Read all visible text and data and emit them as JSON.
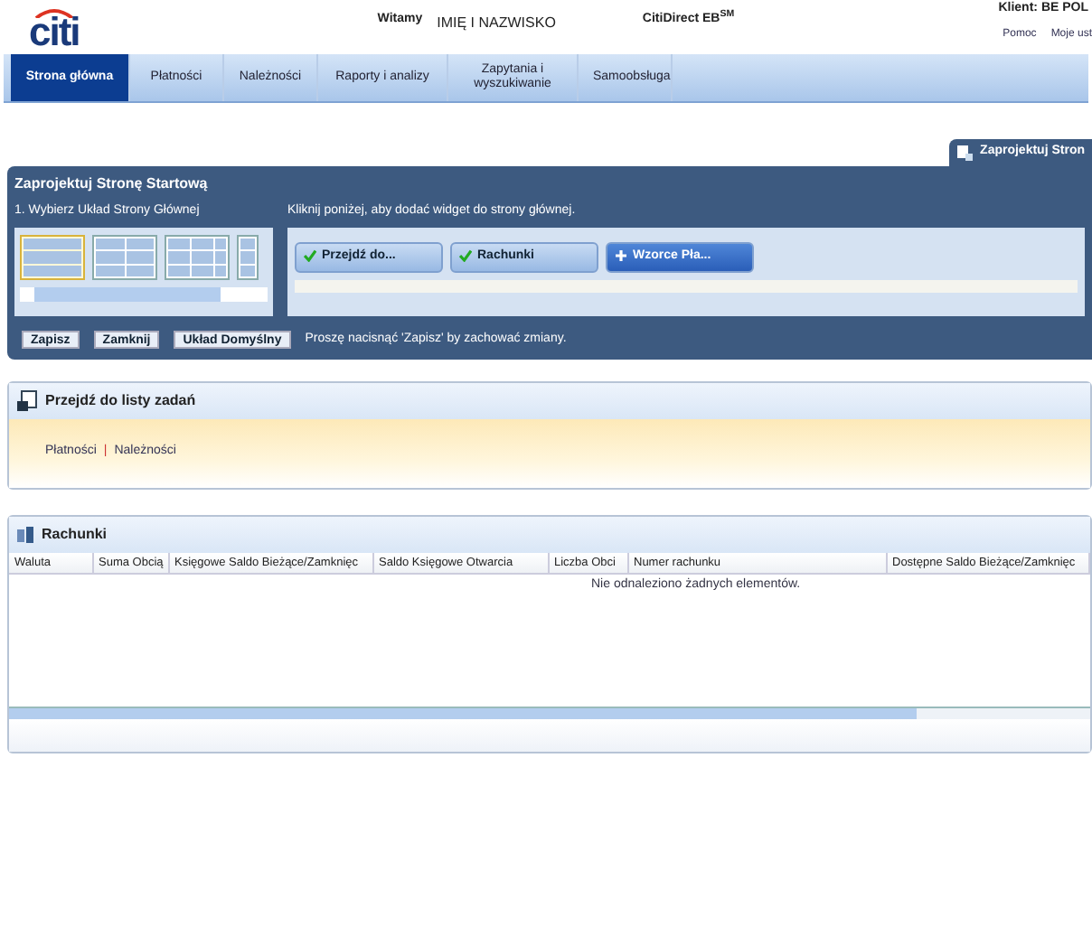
{
  "header": {
    "logo": "citi",
    "greeting": "Witamy",
    "user_name": "IMIĘ I NAZWISKO",
    "product": "CitiDirect EB$^{SM}$",
    "client": "Klient: BE POL",
    "links": [
      "Pomoc",
      "Moje ust"
    ]
  },
  "tabs": [
    {
      "label": "Strona główna",
      "selected": true
    },
    {
      "label": "Płatności",
      "selected": false
    },
    {
      "label": "Należności",
      "selected": false
    },
    {
      "label": "Raporty i analizy",
      "selected": false
    },
    {
      "label": "Zapytania i wyszukiwanie",
      "selected": false
    },
    {
      "label": "Samoobsługa",
      "selected": false
    }
  ],
  "design_tab": {
    "label": "Zaprojektuj Stron"
  },
  "designer": {
    "title": "Zaprojektuj Stronę Startową",
    "layout_label": "1. Wybierz Układ Strony Głównej",
    "layouts": [
      {
        "kind": "single",
        "selected": true
      },
      {
        "kind": "two",
        "selected": false
      },
      {
        "kind": "three",
        "selected": false
      },
      {
        "kind": "partial",
        "selected": false
      }
    ],
    "widget_label": "Kliknij poniżej, aby dodać widget do strony głównej.",
    "widgets": [
      {
        "label": "Przejdź do...",
        "added": true
      },
      {
        "label": "Rachunki",
        "added": true
      },
      {
        "label": "Wzorce Pła...",
        "added": false
      }
    ],
    "buttons": [
      "Zapisz",
      "Zamknij",
      "Układ Domyślny"
    ],
    "hint": "Proszę nacisnąć 'Zapisz' by zachować zmiany."
  },
  "tasks_widget": {
    "title": "Przejdź do listy zadań",
    "links": [
      "Płatności",
      "Należności"
    ],
    "separator": "|"
  },
  "accounts_widget": {
    "title": "Rachunki",
    "columns": [
      "Waluta",
      "Suma Obcią",
      "Księgowe Saldo Bieżące/Zamknięc",
      "Saldo Księgowe Otwarcia",
      "Liczba Obci",
      "Numer rachunku",
      "Dostępne Saldo Bieżące/Zamknięc"
    ],
    "empty_message": "Nie odnaleziono żadnych elementów."
  }
}
